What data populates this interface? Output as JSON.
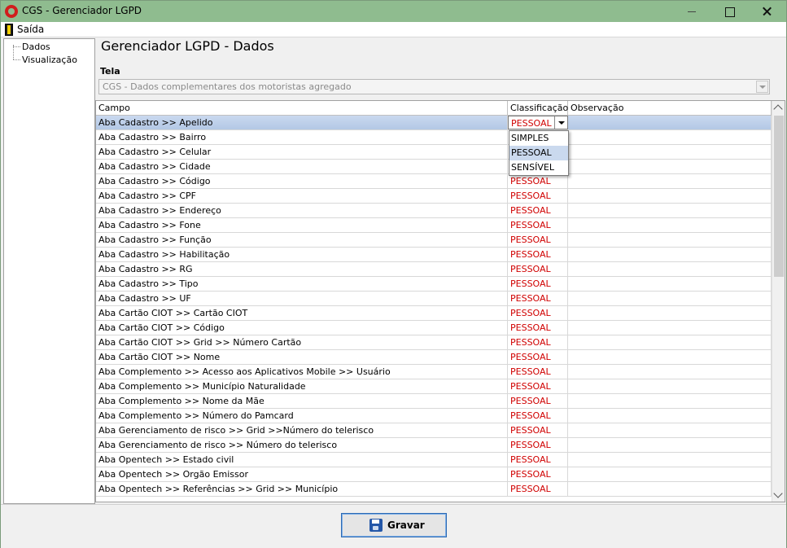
{
  "window": {
    "title": "CGS - Gerenciador LGPD"
  },
  "menu": {
    "saida": "Saída"
  },
  "tree": {
    "items": [
      "Dados",
      "Visualização"
    ]
  },
  "page": {
    "title": "Gerenciador LGPD - Dados",
    "tela_label": "Tela",
    "tela_value": "CGS - Dados complementares dos motoristas agregado"
  },
  "grid": {
    "headers": {
      "campo": "Campo",
      "classificacao": "Classificação",
      "observacao": "Observação"
    },
    "rows": [
      {
        "campo": "Aba Cadastro >> Apelido",
        "classificacao": "PESSOAL",
        "observacao": ""
      },
      {
        "campo": "Aba Cadastro >> Bairro",
        "classificacao": "",
        "observacao": ""
      },
      {
        "campo": "Aba Cadastro >> Celular",
        "classificacao": "",
        "observacao": ""
      },
      {
        "campo": "Aba Cadastro >> Cidade",
        "classificacao": "",
        "observacao": ""
      },
      {
        "campo": "Aba Cadastro >> Código",
        "classificacao": "PESSOAL",
        "observacao": ""
      },
      {
        "campo": "Aba Cadastro >> CPF",
        "classificacao": "PESSOAL",
        "observacao": ""
      },
      {
        "campo": "Aba Cadastro >> Endereço",
        "classificacao": "PESSOAL",
        "observacao": ""
      },
      {
        "campo": "Aba Cadastro >> Fone",
        "classificacao": "PESSOAL",
        "observacao": ""
      },
      {
        "campo": "Aba Cadastro >> Função",
        "classificacao": "PESSOAL",
        "observacao": ""
      },
      {
        "campo": "Aba Cadastro >> Habilitação",
        "classificacao": "PESSOAL",
        "observacao": ""
      },
      {
        "campo": "Aba Cadastro >> RG",
        "classificacao": "PESSOAL",
        "observacao": ""
      },
      {
        "campo": "Aba Cadastro >> Tipo",
        "classificacao": "PESSOAL",
        "observacao": ""
      },
      {
        "campo": "Aba Cadastro >> UF",
        "classificacao": "PESSOAL",
        "observacao": ""
      },
      {
        "campo": "Aba Cartão CIOT >> Cartão CIOT",
        "classificacao": "PESSOAL",
        "observacao": ""
      },
      {
        "campo": "Aba Cartão CIOT >> Código",
        "classificacao": "PESSOAL",
        "observacao": ""
      },
      {
        "campo": "Aba Cartão CIOT >> Grid >> Número Cartão",
        "classificacao": "PESSOAL",
        "observacao": ""
      },
      {
        "campo": "Aba Cartão CIOT >> Nome",
        "classificacao": "PESSOAL",
        "observacao": ""
      },
      {
        "campo": "Aba Complemento >> Acesso aos Aplicativos Mobile >> Usuário",
        "classificacao": "PESSOAL",
        "observacao": ""
      },
      {
        "campo": "Aba Complemento >> Município Naturalidade",
        "classificacao": "PESSOAL",
        "observacao": ""
      },
      {
        "campo": "Aba Complemento >> Nome da Mãe",
        "classificacao": "PESSOAL",
        "observacao": ""
      },
      {
        "campo": "Aba Complemento >> Número do Pamcard",
        "classificacao": "PESSOAL",
        "observacao": ""
      },
      {
        "campo": "Aba Gerenciamento de risco >> Grid >>Número do telerisco",
        "classificacao": "PESSOAL",
        "observacao": ""
      },
      {
        "campo": "Aba Gerenciamento de risco >> Número do telerisco",
        "classificacao": "PESSOAL",
        "observacao": ""
      },
      {
        "campo": "Aba Opentech >> Estado civil",
        "classificacao": "PESSOAL",
        "observacao": ""
      },
      {
        "campo": "Aba Opentech >> Orgão Emissor",
        "classificacao": "PESSOAL",
        "observacao": ""
      },
      {
        "campo": "Aba Opentech >> Referências >> Grid >> Município",
        "classificacao": "PESSOAL",
        "observacao": ""
      }
    ],
    "dropdown_options": [
      "SIMPLES",
      "PESSOAL",
      "SENSÍVEL"
    ]
  },
  "actions": {
    "gravar": "Gravar"
  },
  "colors": {
    "titlebar": "#8fbc8f",
    "classification_text": "#d00000",
    "selection": "#cad9ee"
  },
  "icons": {
    "app": "cgs-logo-icon",
    "saida": "exit-door-icon",
    "gravar": "floppy-disk-icon"
  }
}
